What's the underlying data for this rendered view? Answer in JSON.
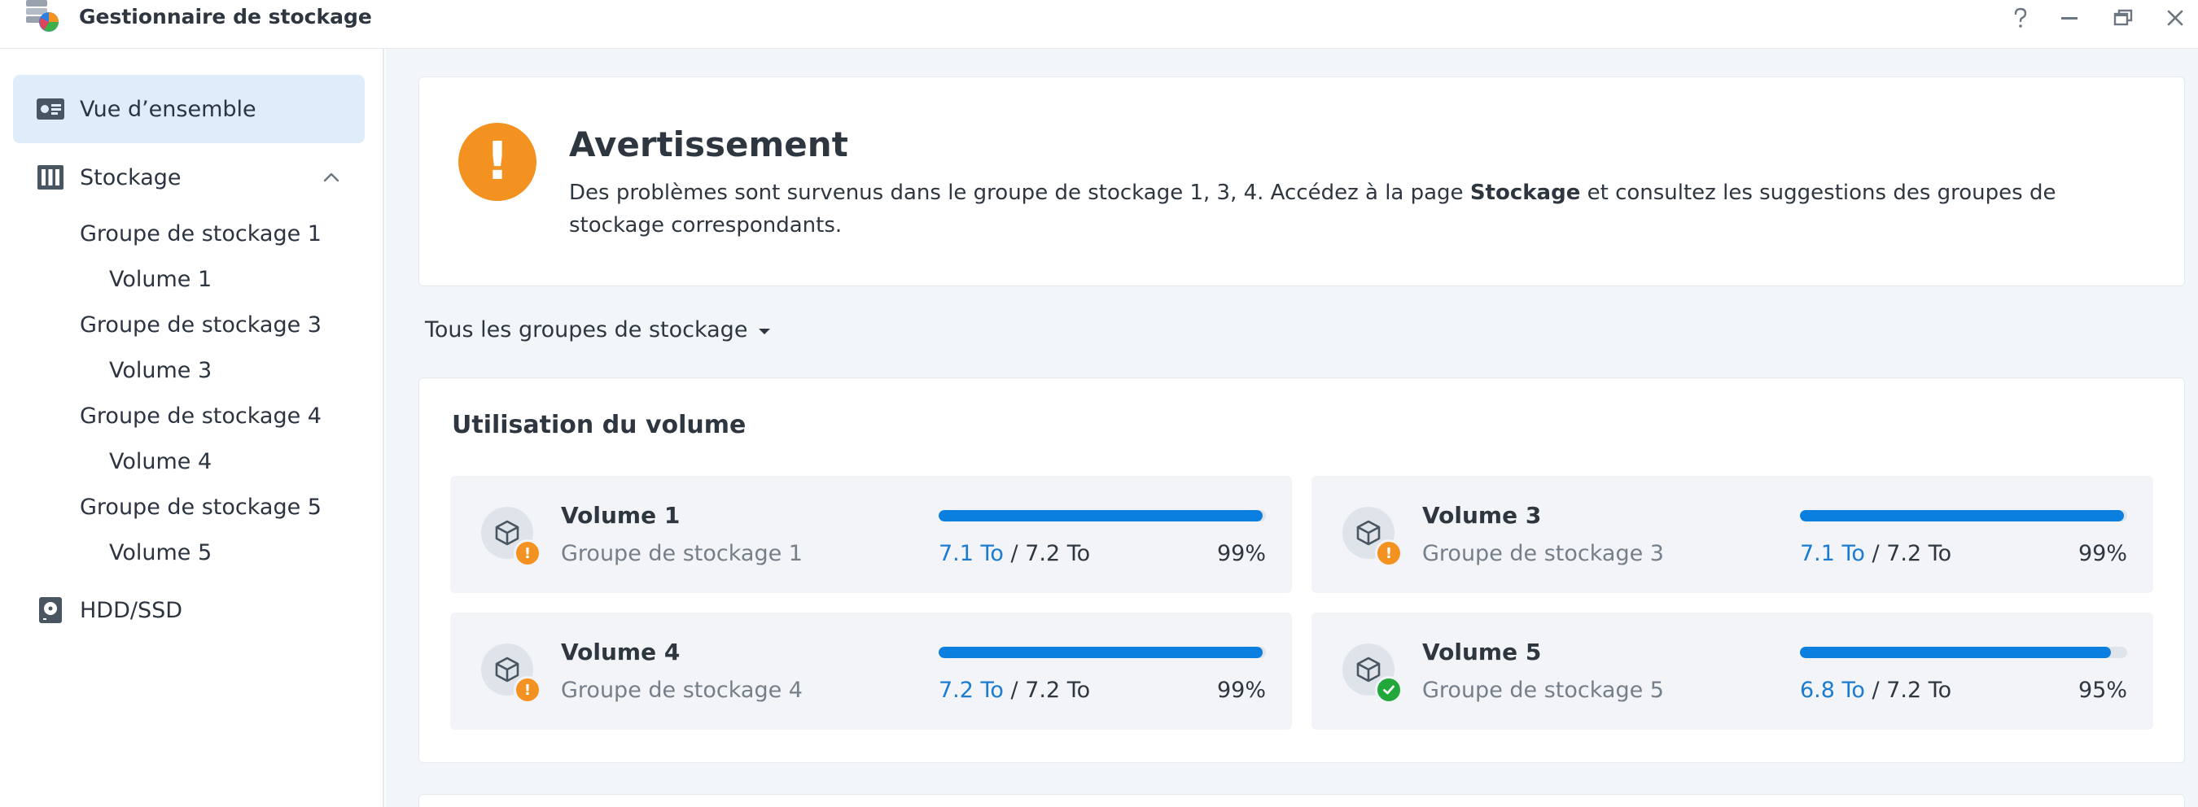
{
  "window": {
    "title": "Gestionnaire de stockage",
    "icon": "storage-manager-icon",
    "controls": [
      "help-icon",
      "minimize-icon",
      "restore-icon",
      "close-icon"
    ]
  },
  "sidebar": {
    "overview": "Vue d’ensemble",
    "storage": "Stockage",
    "pools": [
      {
        "label": "Groupe de stockage 1",
        "volume": "Volume 1"
      },
      {
        "label": "Groupe de stockage 3",
        "volume": "Volume 3"
      },
      {
        "label": "Groupe de stockage 4",
        "volume": "Volume 4"
      },
      {
        "label": "Groupe de stockage 5",
        "volume": "Volume 5"
      }
    ],
    "hdd": "HDD/SSD"
  },
  "warning": {
    "title": "Avertissement",
    "text_before": "Des problèmes sont survenus dans le groupe de stockage 1, 3, 4. Accédez à la page ",
    "text_bold": "Stockage",
    "text_after": " et consultez les suggestions des groupes de stockage correspondants."
  },
  "filter": {
    "label": "Tous les groupes de stockage"
  },
  "volume_usage": {
    "title": "Utilisation du volume",
    "volumes": [
      {
        "name": "Volume 1",
        "pool": "Groupe de stockage 1",
        "used": "7.1 To",
        "total": "/ 7.2 To",
        "percent_label": "99%",
        "fill_pct": 99,
        "status": "warning"
      },
      {
        "name": "Volume 3",
        "pool": "Groupe de stockage 3",
        "used": "7.1 To",
        "total": "/ 7.2 To",
        "percent_label": "99%",
        "fill_pct": 99,
        "status": "warning"
      },
      {
        "name": "Volume 4",
        "pool": "Groupe de stockage 4",
        "used": "7.2 To",
        "total": "/ 7.2 To",
        "percent_label": "99%",
        "fill_pct": 99,
        "status": "warning"
      },
      {
        "name": "Volume 5",
        "pool": "Groupe de stockage 5",
        "used": "6.8 To",
        "total": "/ 7.2 To",
        "percent_label": "95%",
        "fill_pct": 95,
        "status": "ok"
      }
    ]
  },
  "colors": {
    "accent": "#0a7fe0",
    "warning": "#f39220",
    "ok": "#22a83a",
    "active_nav": "#dfedfb"
  }
}
